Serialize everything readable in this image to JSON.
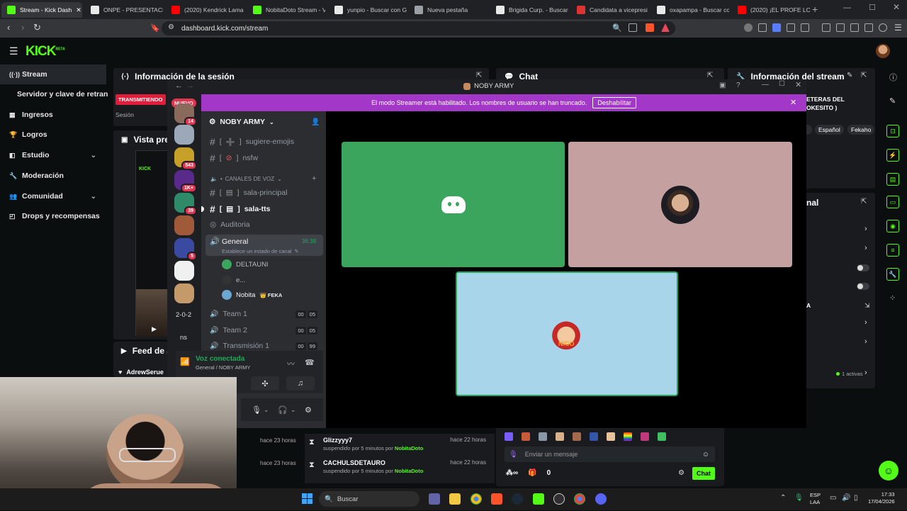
{
  "browser": {
    "tabs": [
      {
        "title": "Stream - Kick Dash",
        "color": "#53fc18",
        "active": true
      },
      {
        "title": "ONPE - PRESENTACIÓ",
        "color": "#e8e8e8"
      },
      {
        "title": "(2020) Kendrick Lama",
        "color": "#ff0000"
      },
      {
        "title": "NobitaDoto Stream - V",
        "color": "#53fc18"
      },
      {
        "title": "yunpio - Buscar con G",
        "color": "#e8e8e8"
      },
      {
        "title": "Nueva pestaña",
        "color": "#9aa0a6"
      },
      {
        "title": "Brigida Curp. - Buscar",
        "color": "#e8e8e8"
      },
      {
        "title": "Candidata a vicepresi",
        "color": "#d33"
      },
      {
        "title": "oxapampa - Buscar co",
        "color": "#e8e8e8"
      },
      {
        "title": "(2020) ¡EL PROFE LO A",
        "color": "#ff0000"
      }
    ],
    "url": "dashboard.kick.com/stream"
  },
  "kick": {
    "logo": "KICK",
    "logo_beta": "BETA",
    "nav": [
      {
        "label": "Stream",
        "icon": "stream-icon",
        "glyph": "((·))"
      },
      {
        "label": "Servidor y clave de retransmi",
        "icon": "",
        "glyph": ""
      },
      {
        "label": "Ingresos",
        "icon": "revenue-icon",
        "glyph": "▦"
      },
      {
        "label": "Logros",
        "icon": "trophy-icon",
        "glyph": "🏆"
      },
      {
        "label": "Estudio",
        "icon": "studio-icon",
        "glyph": "◧"
      },
      {
        "label": "Moderación",
        "icon": "wrench-icon",
        "glyph": "🔧"
      },
      {
        "label": "Comunidad",
        "icon": "community-icon",
        "glyph": "👥"
      },
      {
        "label": "Drops y recompensas",
        "icon": "drops-icon",
        "glyph": "◰"
      }
    ],
    "session_title": "Información de la sesión",
    "live_badge": "TRANSMITIENDO",
    "session_label": "Sesión",
    "preview_title": "Vista pre",
    "feed_title": "Feed de a",
    "feed_user": "AdrewSerue",
    "chat_title": "Chat",
    "stream_info_title": "Información del stream",
    "stream_info_text1": "ETERAS DEL",
    "stream_info_text2": "OKESITO )",
    "tag_lang": "Español",
    "tag_other": "Fekaho",
    "channel_section": "nal",
    "channel_a": "A",
    "active_count": "1 activas",
    "mod_log": [
      {
        "user": "Glizzyyy7",
        "action": "suspendido por 5 minutos por",
        "mod": "NobitaDoto",
        "time": "hace 22 horas"
      },
      {
        "user": "CACHULSDETAURO",
        "action": "suspendido por 5 minutos por",
        "mod": "NobitaDoto",
        "time": "hace 22 horas"
      }
    ],
    "left_times": [
      "hace 23 horas",
      "hace 23 horas"
    ],
    "chat_placeholder": "Enviar un mensaje",
    "chat_count": "0",
    "chat_button": "Chat"
  },
  "discord": {
    "window_title": "NOBY ARMY",
    "banner_text": "El modo Streamer está habilitado. Los nombres de usuario se han truncado.",
    "banner_button": "Deshabilitar",
    "server_name": "NOBY ARMY",
    "nuevo_label": "NUEVO",
    "server_badges": [
      "14",
      "543",
      "1K+",
      "39",
      "5"
    ],
    "server_text1": "2-0-2",
    "server_text2": "ns",
    "channels_top": [
      "sugiere-emojis",
      "nsfw"
    ],
    "voice_header": "CANALES DE VOZ",
    "text_voice_channels": [
      "sala-principal",
      "sala-tts"
    ],
    "stage_channel": "Auditoria",
    "general": {
      "name": "General",
      "time": "36:38",
      "status": "Establece un estado de canal"
    },
    "members": [
      {
        "name": "DELTAUNI",
        "tag": ""
      },
      {
        "name": "e...",
        "tag": ""
      },
      {
        "name": "Nobita",
        "tag": "FEKA"
      }
    ],
    "voice_channels": [
      {
        "name": "Team 1",
        "a": "00",
        "b": "05"
      },
      {
        "name": "Team 2",
        "a": "00",
        "b": "05"
      },
      {
        "name": "Transmisión 1",
        "a": "00",
        "b": "99"
      }
    ],
    "voice_status": "Voz conectada",
    "voice_location": "General / NOBY ARMY",
    "tiles": [
      {
        "color": "#3ba55d",
        "label": "discord-logo"
      },
      {
        "color": "#c4a0a0",
        "label": "avatar"
      },
      {
        "color": "#a8d5ea",
        "label": "avatar-cartoon",
        "text": "NICO"
      }
    ]
  },
  "taskbar": {
    "search_placeholder": "Buscar",
    "lang": "ESP",
    "lang2": "LAA",
    "time": "17:33",
    "date": "17/04/2026"
  },
  "colors": {
    "kick_green": "#53fc18",
    "discord_purple": "#a337c7",
    "live_red": "#e01e3c"
  }
}
